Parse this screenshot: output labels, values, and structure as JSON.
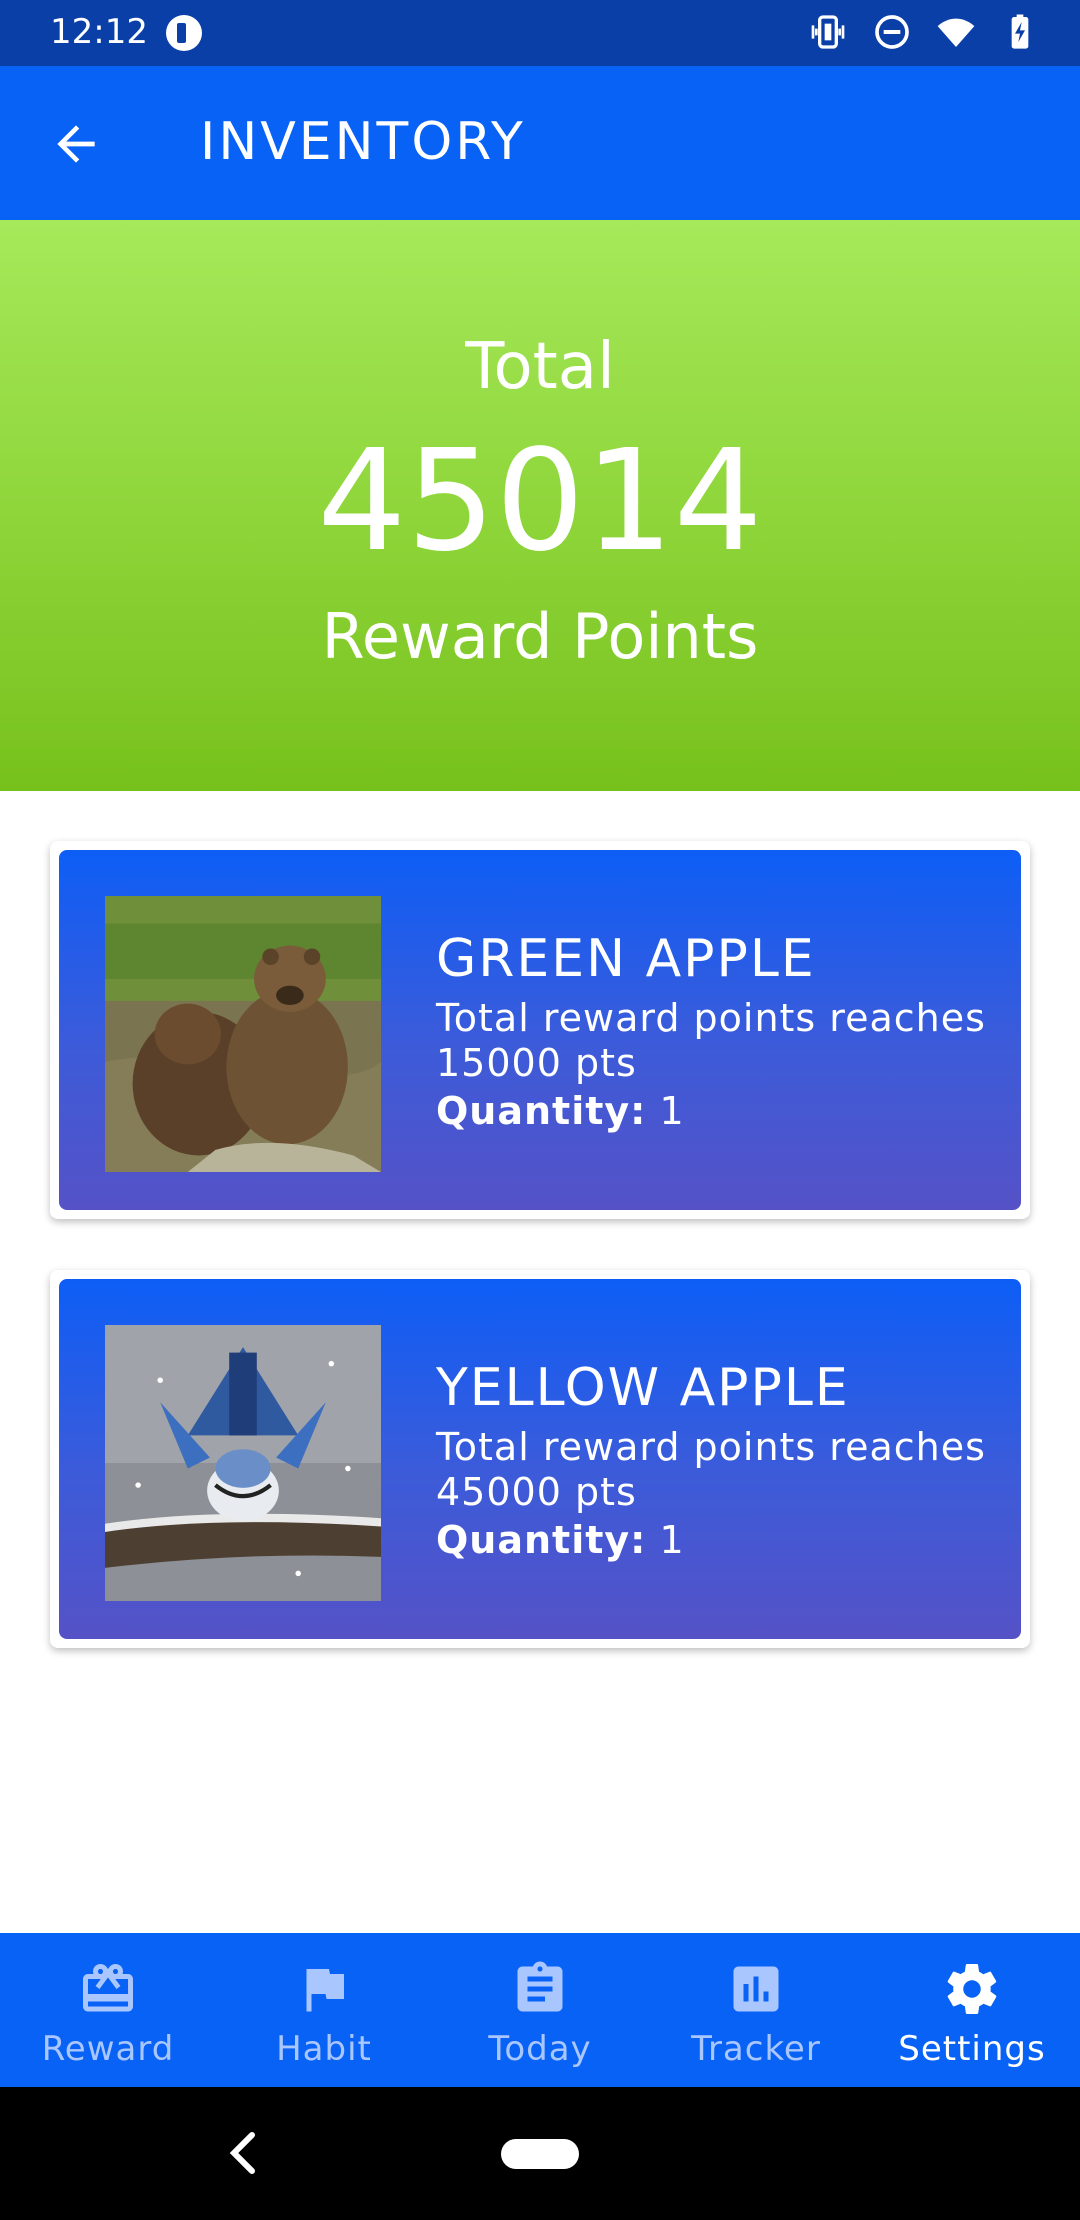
{
  "status_bar": {
    "time": "12:12",
    "icons": [
      "app-notification-icon",
      "vibrate-icon",
      "do-not-disturb-icon",
      "wifi-icon",
      "battery-charging-icon"
    ]
  },
  "app_bar": {
    "title": "INVENTORY",
    "back_icon": "arrow-back-icon"
  },
  "summary": {
    "top_label": "Total",
    "points": "45014",
    "bottom_label": "Reward Points"
  },
  "inventory": [
    {
      "name": "GREEN APPLE",
      "description": "Total reward points reaches 15000 pts",
      "quantity_label": "Quantity:",
      "quantity": "1",
      "image": "two-bears-in-water"
    },
    {
      "name": "YELLOW APPLE",
      "description": "Total reward points reaches 45000 pts",
      "quantity_label": "Quantity:",
      "quantity": "1",
      "image": "blue-jay-on-branch"
    }
  ],
  "bottom_nav": [
    {
      "label": "Reward",
      "icon": "gift-card-icon",
      "active": false
    },
    {
      "label": "Habit",
      "icon": "flag-icon",
      "active": false
    },
    {
      "label": "Today",
      "icon": "clipboard-icon",
      "active": false
    },
    {
      "label": "Tracker",
      "icon": "bar-chart-icon",
      "active": false
    },
    {
      "label": "Settings",
      "icon": "gear-icon",
      "active": true
    }
  ],
  "colors": {
    "status_bar": "#0a3fa8",
    "app_bar": "#0762f5",
    "hero_top": "#a6e95a",
    "hero_bottom": "#77c11c",
    "card_top": "#0d5ef6",
    "card_bottom": "#5552c6",
    "nav_inactive": "#a9c6ff",
    "nav_active": "#ffffff"
  }
}
